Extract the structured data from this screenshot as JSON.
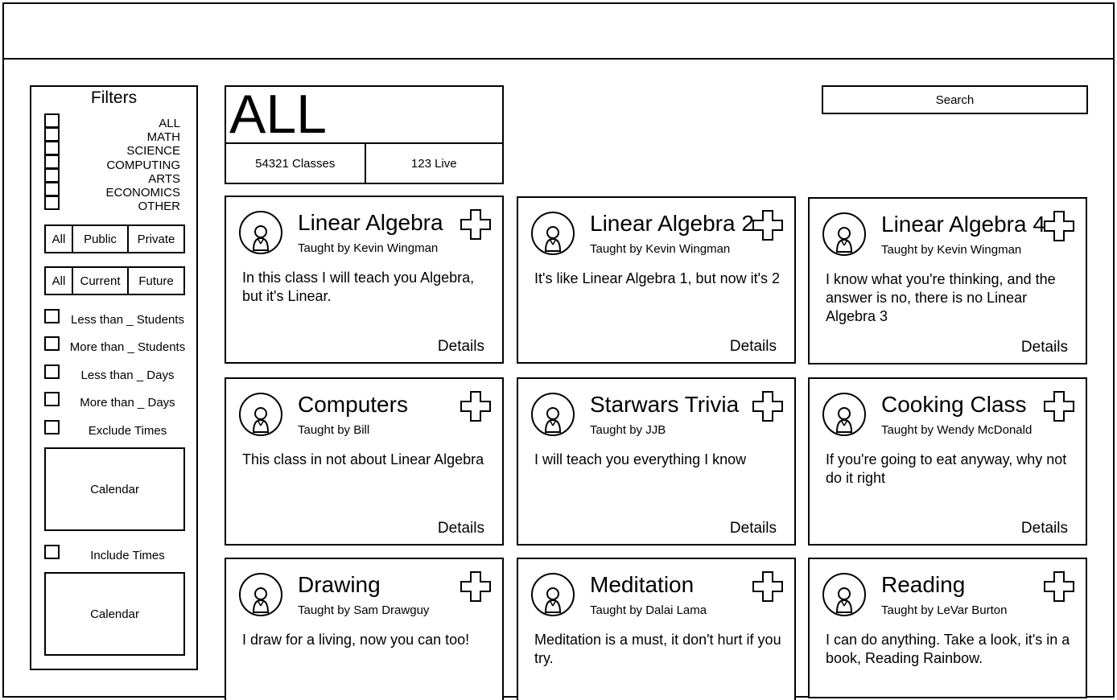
{
  "sidebar": {
    "title": "Filters",
    "categories": [
      "ALL",
      "MATH",
      "SCIENCE",
      "COMPUTING",
      "ARTS",
      "ECONOMICS",
      "OTHER"
    ],
    "visibility": [
      "All",
      "Public",
      "Private"
    ],
    "timing": [
      "All",
      "Current",
      "Future"
    ],
    "options": [
      "Less than _ Students",
      "More than _ Students",
      "Less than _ Days",
      "More than _ Days",
      "Exclude Times"
    ],
    "calendar1": "Calendar",
    "include_times": "Include Times",
    "calendar2": "Calendar"
  },
  "header": {
    "title": "ALL",
    "classes": "54321 Classes",
    "live": "123 Live"
  },
  "search": {
    "label": "Search"
  },
  "cards": [
    {
      "title": "Linear Algebra",
      "teacher": "Taught by Kevin Wingman",
      "desc": "In this class I will teach you Algebra, but it's Linear.",
      "details": "Details"
    },
    {
      "title": "Linear Algebra 2",
      "teacher": "Taught by Kevin Wingman",
      "desc": "It's like Linear Algebra 1, but now it's 2",
      "details": "Details"
    },
    {
      "title": "Linear Algebra 4",
      "teacher": "Taught by Kevin Wingman",
      "desc": "I know what you're thinking, and the answer is no, there is no Linear Algebra 3",
      "details": "Details"
    },
    {
      "title": "Computers",
      "teacher": "Taught by Bill",
      "desc": "This class in not about Linear Algebra",
      "details": "Details"
    },
    {
      "title": "Starwars Trivia",
      "teacher": "Taught by JJB",
      "desc": "I will teach you everything I know",
      "details": "Details"
    },
    {
      "title": "Cooking Class",
      "teacher": "Taught by Wendy McDonald",
      "desc": "If you're going to eat anyway, why not do it right",
      "details": "Details"
    },
    {
      "title": "Drawing",
      "teacher": "Taught by Sam Drawguy",
      "desc": "I draw for a living, now you can too!",
      "details": ""
    },
    {
      "title": "Meditation",
      "teacher": "Taught by Dalai Lama",
      "desc": "Meditation is a must, it don't hurt if you try.",
      "details": ""
    },
    {
      "title": "Reading",
      "teacher": "Taught by LeVar Burton",
      "desc": "I can do anything. Take a look, it's in a book, Reading Rainbow.",
      "details": ""
    }
  ]
}
